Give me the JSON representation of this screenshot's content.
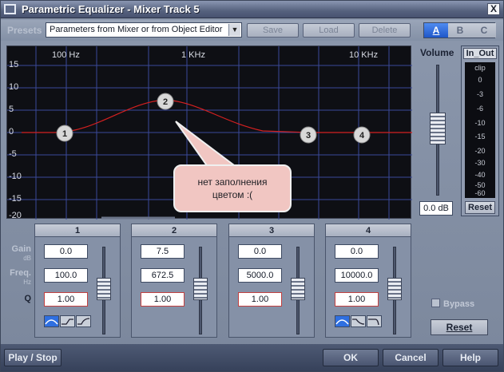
{
  "window": {
    "title": "Parametric Equalizer - Mixer Track 5",
    "close_glyph": "X"
  },
  "presets": {
    "label": "Presets",
    "selected": "Parameters from Mixer or from Object Editor",
    "save": "Save",
    "load": "Load",
    "delete": "Delete",
    "ab": [
      "A",
      "B",
      "C"
    ]
  },
  "graph": {
    "freq_labels": [
      "100 Hz",
      "1 KHz",
      "10 KHz"
    ],
    "db_labels": [
      "15",
      "10",
      "5",
      "0",
      "-5",
      "-10",
      "-15",
      "-20"
    ],
    "nodes": [
      "1",
      "2",
      "3",
      "4"
    ]
  },
  "volume": {
    "label": "Volume",
    "value": "0.0 dB"
  },
  "meter": {
    "label": "In_Out",
    "ticks": [
      "clip",
      "0",
      "-3",
      "-6",
      "-10",
      "-15",
      "-20",
      "-30",
      "-40",
      "-50",
      "-60"
    ],
    "reset": "Reset"
  },
  "side": {
    "gain": "Gain",
    "gain_unit": "dB",
    "freq": "Freq.",
    "freq_unit": "Hz",
    "q": "Q"
  },
  "bands": [
    {
      "name": "1",
      "gain": "0.0",
      "freq": "100.0",
      "q": "1.00"
    },
    {
      "name": "2",
      "gain": "7.5",
      "freq": "672.5",
      "q": "1.00"
    },
    {
      "name": "3",
      "gain": "0.0",
      "freq": "5000.0",
      "q": "1.00"
    },
    {
      "name": "4",
      "gain": "0.0",
      "freq": "10000.0",
      "q": "1.00"
    }
  ],
  "bypass": "Bypass",
  "reset": "Reset",
  "bottom": {
    "play_stop": "Play / Stop",
    "ok": "OK",
    "cancel": "Cancel",
    "help": "Help"
  },
  "callout": {
    "line1": "нет заполнения",
    "line2": "цветом :("
  },
  "colors": {
    "curve": "#d42020",
    "grid": "#3b4a9a",
    "active_tab": "#2a63d6"
  }
}
